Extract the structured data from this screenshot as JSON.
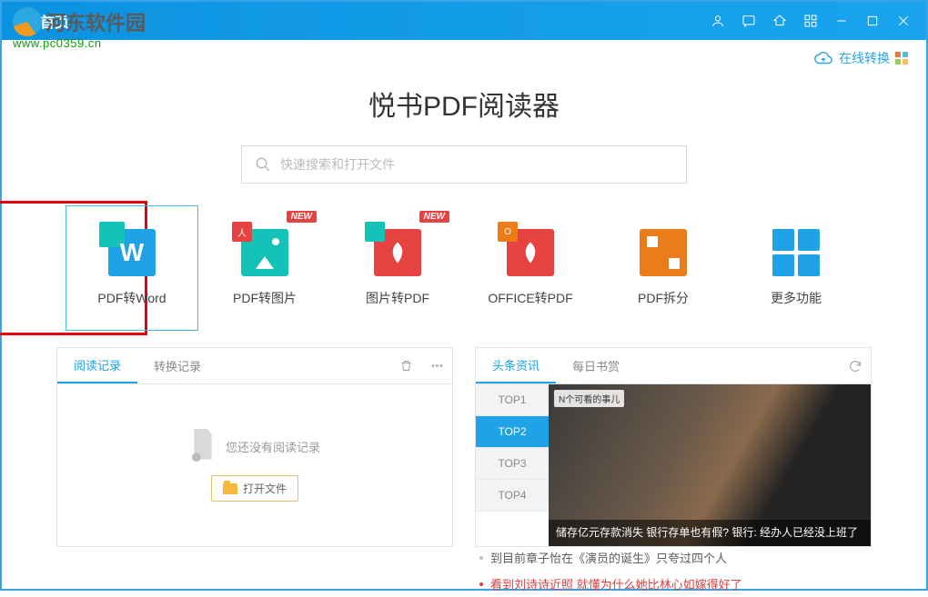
{
  "watermark": {
    "text": "河东软件园",
    "url": "www.pc0359.cn"
  },
  "titlebar": {
    "home": "首页"
  },
  "header": {
    "online_convert": "在线转换"
  },
  "app_title": "悦书PDF阅读器",
  "search": {
    "placeholder": "快速搜索和打开文件"
  },
  "tiles": [
    {
      "id": "pdf-to-word",
      "label": "PDF转Word",
      "active": true,
      "badge": null
    },
    {
      "id": "pdf-to-image",
      "label": "PDF转图片",
      "badge": "NEW"
    },
    {
      "id": "image-to-pdf",
      "label": "图片转PDF",
      "badge": "NEW"
    },
    {
      "id": "office-to-pdf",
      "label": "OFFICE转PDF",
      "badge": null
    },
    {
      "id": "pdf-split",
      "label": "PDF拆分",
      "badge": null
    },
    {
      "id": "more",
      "label": "更多功能",
      "badge": null
    }
  ],
  "left_panel": {
    "tabs": [
      "阅读记录",
      "转换记录"
    ],
    "active_tab": 0,
    "empty_text": "您还没有阅读记录",
    "open_file": "打开文件"
  },
  "right_panel": {
    "tabs": [
      "头条资讯",
      "每日书赏"
    ],
    "active_tab": 0,
    "toplist": [
      "TOP1",
      "TOP2",
      "TOP3",
      "TOP4"
    ],
    "active_top": 1,
    "image_tag": "N个可看的事儿",
    "caption": "储存亿元存款消失 银行存单也有假? 银行: 经办人已经没上班了",
    "links": [
      {
        "text": "到目前章子怡在《演员的诞生》只夸过四个人",
        "red": false
      },
      {
        "text": "看到刘诗诗近照 就懂为什么她比林心如嫁得好了",
        "red": true
      }
    ]
  }
}
